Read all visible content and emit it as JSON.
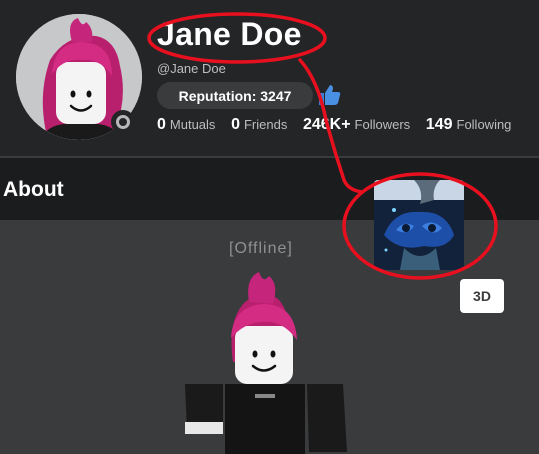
{
  "profile": {
    "display_name": "Jane Doe",
    "username": "@Jane Doe",
    "reputation": "Reputation: 3247",
    "status_color": "#b8b8b8"
  },
  "stats": [
    {
      "value": "0",
      "label": "Mutuals"
    },
    {
      "value": "0",
      "label": "Friends"
    },
    {
      "value": "246K+",
      "label": "Followers"
    },
    {
      "value": "149",
      "label": "Following"
    }
  ],
  "about": {
    "title": "About",
    "presence": "[Offline]",
    "view_3d_label": "3D"
  },
  "icons": {
    "thumb": "thumbs-up-icon",
    "status": "offline-status-icon"
  },
  "colors": {
    "annotation": "#e8101e",
    "hair": "#c5257a",
    "panel": "#393b3d"
  }
}
